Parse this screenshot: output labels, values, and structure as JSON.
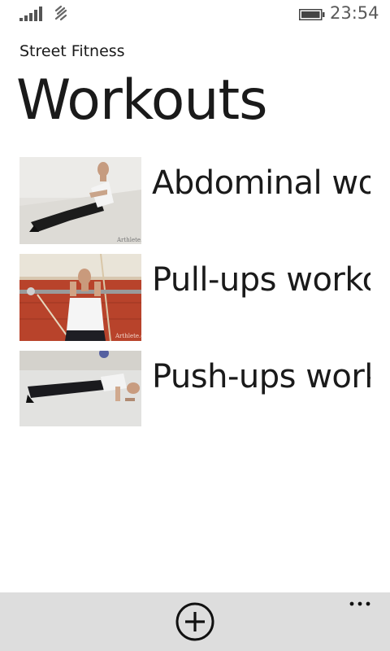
{
  "status_bar": {
    "time": "23:54",
    "signal_icon": "signal-strength-icon",
    "data_icon": "data-connection-icon",
    "battery_icon": "battery-icon"
  },
  "header": {
    "app_title": "Street Fitness",
    "page_title": "Workouts"
  },
  "workouts": [
    {
      "label": "Abdominal workout",
      "image": "situps-photo",
      "watermark": "Arthlete.com"
    },
    {
      "label": "Pull-ups workout",
      "image": "pullups-photo",
      "watermark": "Arthlete.com"
    },
    {
      "label": "Push-ups workout",
      "image": "pushups-photo",
      "watermark": ""
    }
  ],
  "app_bar": {
    "add_icon": "add-circle-icon",
    "more_icon": "ellipsis-icon",
    "background": "#dddddd"
  }
}
